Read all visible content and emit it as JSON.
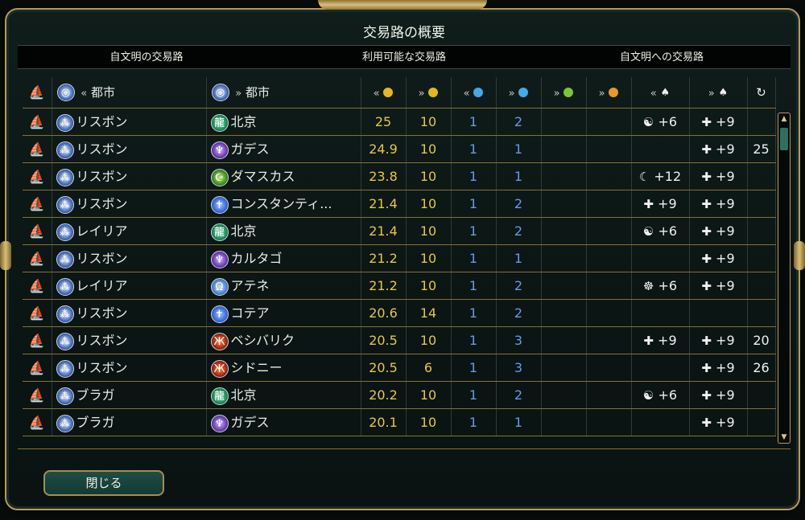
{
  "window": {
    "title": "交易路の概要"
  },
  "tabs": [
    "自文明の交易路",
    "利用可能な交易路",
    "自文明への交易路"
  ],
  "columns": {
    "from_city": "都市",
    "to_city": "都市"
  },
  "column_icons": [
    "ship-icon",
    "from-civ-icon",
    "to-civ-icon",
    "gold-left",
    "gold-right",
    "science-left",
    "science-right",
    "food-right",
    "production-right",
    "religion-left",
    "religion-right",
    "turns-icon"
  ],
  "rows": [
    {
      "from": "リスボン",
      "to": "北京",
      "to_civ": "china",
      "g1": "25",
      "g2": "10",
      "s1": "1",
      "s2": "2",
      "rel1": "+6",
      "rel1_icon": "☯",
      "rel2": "+9",
      "turns": ""
    },
    {
      "from": "リスボン",
      "to": "ガデス",
      "to_civ": "carth",
      "g1": "24.9",
      "g2": "10",
      "s1": "1",
      "s2": "1",
      "rel1": "",
      "rel1_icon": "",
      "rel2": "+9",
      "turns": "25"
    },
    {
      "from": "リスボン",
      "to": "ダマスカス",
      "to_civ": "arab",
      "g1": "23.8",
      "g2": "10",
      "s1": "1",
      "s2": "1",
      "rel1": "+12",
      "rel1_icon": "☾",
      "rel2": "+9",
      "turns": ""
    },
    {
      "from": "リスボン",
      "to": "コンスタンティ...",
      "to_civ": "byz",
      "g1": "21.4",
      "g2": "10",
      "s1": "1",
      "s2": "2",
      "rel1": "+9",
      "rel1_icon": "✚",
      "rel2": "+9",
      "turns": ""
    },
    {
      "from": "レイリア",
      "to": "北京",
      "to_civ": "china",
      "g1": "21.4",
      "g2": "10",
      "s1": "1",
      "s2": "2",
      "rel1": "+6",
      "rel1_icon": "☯",
      "rel2": "+9",
      "turns": ""
    },
    {
      "from": "リスボン",
      "to": "カルタゴ",
      "to_civ": "carth",
      "g1": "21.2",
      "g2": "10",
      "s1": "1",
      "s2": "1",
      "rel1": "",
      "rel1_icon": "",
      "rel2": "+9",
      "turns": ""
    },
    {
      "from": "レイリア",
      "to": "アテネ",
      "to_civ": "greek",
      "g1": "21.2",
      "g2": "10",
      "s1": "1",
      "s2": "2",
      "rel1": "+6",
      "rel1_icon": "☸",
      "rel2": "+9",
      "turns": ""
    },
    {
      "from": "リスボン",
      "to": "コテア",
      "to_civ": "byz",
      "g1": "20.6",
      "g2": "14",
      "s1": "1",
      "s2": "2",
      "rel1": "",
      "rel1_icon": "",
      "rel2": "",
      "turns": ""
    },
    {
      "from": "リスボン",
      "to": "ベシバリク",
      "to_civ": "huns",
      "g1": "20.5",
      "g2": "10",
      "s1": "1",
      "s2": "3",
      "rel1": "+9",
      "rel1_icon": "✚",
      "rel2": "+9",
      "turns": "20"
    },
    {
      "from": "リスボン",
      "to": "シドニー",
      "to_civ": "huns",
      "g1": "20.5",
      "g2": "6",
      "s1": "1",
      "s2": "3",
      "rel1": "",
      "rel1_icon": "",
      "rel2": "+9",
      "turns": "26"
    },
    {
      "from": "ブラガ",
      "to": "北京",
      "to_civ": "china",
      "g1": "20.2",
      "g2": "10",
      "s1": "1",
      "s2": "2",
      "rel1": "+6",
      "rel1_icon": "☯",
      "rel2": "+9",
      "turns": ""
    },
    {
      "from": "ブラガ",
      "to": "ガデス",
      "to_civ": "carth",
      "g1": "20.1",
      "g2": "10",
      "s1": "1",
      "s2": "1",
      "rel1": "",
      "rel1_icon": "",
      "rel2": "+9",
      "turns": ""
    }
  ],
  "civ_glyphs": {
    "port": "⁂",
    "china": "龍",
    "carth": "♆",
    "arab": "☪",
    "byz": "✝",
    "greek": "Ω",
    "huns": "Ж"
  },
  "buttons": {
    "close": "閉じる"
  }
}
